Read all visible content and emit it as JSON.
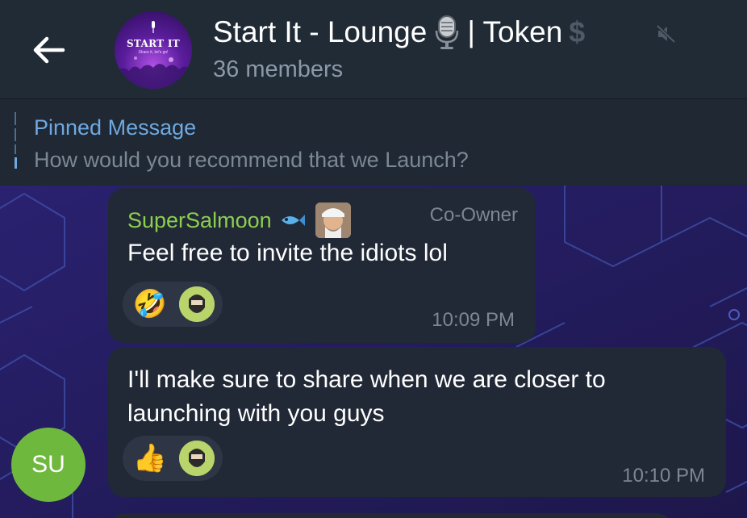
{
  "header": {
    "title": "Start It - Lounge",
    "title_suffix": "| Token",
    "dollar_sign": "$",
    "members": "36 members",
    "avatar_text": "START IT",
    "avatar_subtext": "Share it, let's go!"
  },
  "pinned": {
    "label": "Pinned Message",
    "text": "How would you recommend that we Launch?"
  },
  "messages": [
    {
      "sender": "SuperSalmoon",
      "role": "Co-Owner",
      "text": "Feel free to invite the idiots lol",
      "time": "10:09 PM",
      "reaction_emoji": "🤣"
    },
    {
      "text": "I'll make sure to share when we are closer to launching with you guys",
      "time": "10:10 PM",
      "reaction_emoji": "👍"
    }
  ],
  "user_avatar": {
    "initials": "SU",
    "color": "#6fb83e"
  },
  "colors": {
    "header_bg": "#212b36",
    "bubble_bg": "#212836",
    "sender_green": "#8ccf4f",
    "pinned_blue": "#6fa9e1",
    "chat_bg": "#231c55"
  }
}
